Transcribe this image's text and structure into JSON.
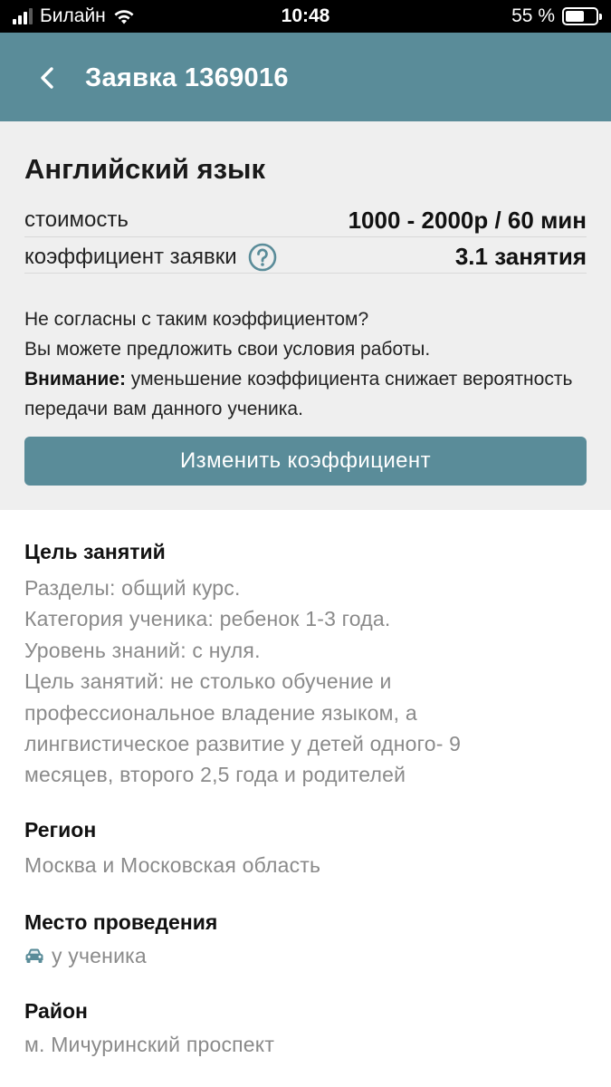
{
  "status_bar": {
    "carrier": "Билайн",
    "time": "10:48",
    "battery": "55 %"
  },
  "header": {
    "title": "Заявка 1369016",
    "icons": {
      "back": "chevron-left-icon"
    }
  },
  "summary": {
    "subject": "Английский язык",
    "cost_label": "стоимость",
    "cost_value": "1000 - 2000р / 60 мин",
    "coef_label": "коэффициент заявки",
    "coef_value": "3.1 занятия",
    "note_line1": "Не согласны с таким коэффициентом?",
    "note_line2": "Вы можете предложить свои условия работы.",
    "note_warning_label": "Внимание:",
    "note_warning_text": " уменьшение коэффициента снижает вероятность передачи вам данного ученика.",
    "change_button": "Изменить коэффициент"
  },
  "details": {
    "goal_title": "Цель занятий",
    "goal_lines": [
      "Разделы: общий курс.",
      "Категория ученика: ребенок 1-3 года.",
      "Уровень знаний: с нуля.",
      "Цель занятий: не столько обучение и",
      "профессиональное владение языком, а",
      "лингвистическое развитие у детей одного- 9",
      "месяцев, второго 2,5 года и родителей"
    ],
    "region_title": "Регион",
    "region_text": "Москва и Московская область",
    "place_title": "Место проведения",
    "place_text": "у ученика",
    "district_title": "Район",
    "district_text": "м. Мичуринский проспект"
  },
  "colors": {
    "accent": "#5a8c99",
    "card_bg": "#efefef",
    "muted_text": "#8a8a8a",
    "help_icon": "#5a8c99"
  }
}
